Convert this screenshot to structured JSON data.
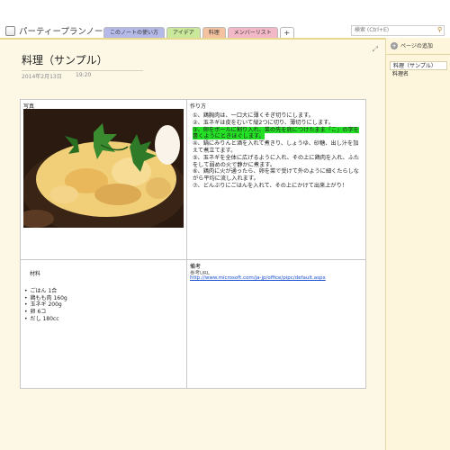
{
  "notebook": {
    "title": "パーティープランノート"
  },
  "tabs": [
    {
      "label": "このノートの使い方",
      "color": "#b4b9e8"
    },
    {
      "label": "アイデア",
      "color": "#c9e89a"
    },
    {
      "label": "料理",
      "color": "#f4c2a0"
    },
    {
      "label": "メンバーリスト",
      "color": "#f2b8c8"
    }
  ],
  "search": {
    "placeholder": "検索 (Ctrl+E)"
  },
  "page": {
    "title": "料理（サンプル）",
    "date": "2014年2月13日",
    "time": "19:20"
  },
  "table": {
    "photo_header": "写真",
    "steps_header": "作り方",
    "steps": [
      "①、鶏胸肉は、一口大に薄くそぎ切りにします。",
      "②、玉ネギは皮をむいて縦2つに切り、薄切りにします。",
      "③、卵をボールに割り入れ、菜の先を底につけたまま「こ」の字を書くようにときほぐします。",
      "④、鍋にみりんと酒を入れて煮きり、しょうゆ、砂糖、出し汁を加えて煮立てます。",
      "⑤、玉ネギを全体に広げるように入れ、その上に鶏肉を入れ、ふたをして弱めの火で静かに煮ます。",
      "⑥、鶏肉に火が通ったら、卵を菜で受けて外のように細くたらしながら平均に流し入れます。",
      "⑦、どんぶりにごはんを入れて、その上にかけて出来上がり！"
    ],
    "highlight_color": "#24e024",
    "ingredients_header": "材料",
    "ingredients": [
      "ごはん 1合",
      "鶏もも肉 160g",
      "玉ネギ 200g",
      "卵 6コ",
      "だし 180cc"
    ],
    "notes_header": "備考",
    "ref_label": "参考URL",
    "ref_url": "http://www.microsoft.com/ja-jp/office/pipc/default.aspx"
  },
  "sidebar": {
    "add_page": "ページの追加",
    "pages": [
      "料理（サンプル）",
      "料理名"
    ]
  }
}
